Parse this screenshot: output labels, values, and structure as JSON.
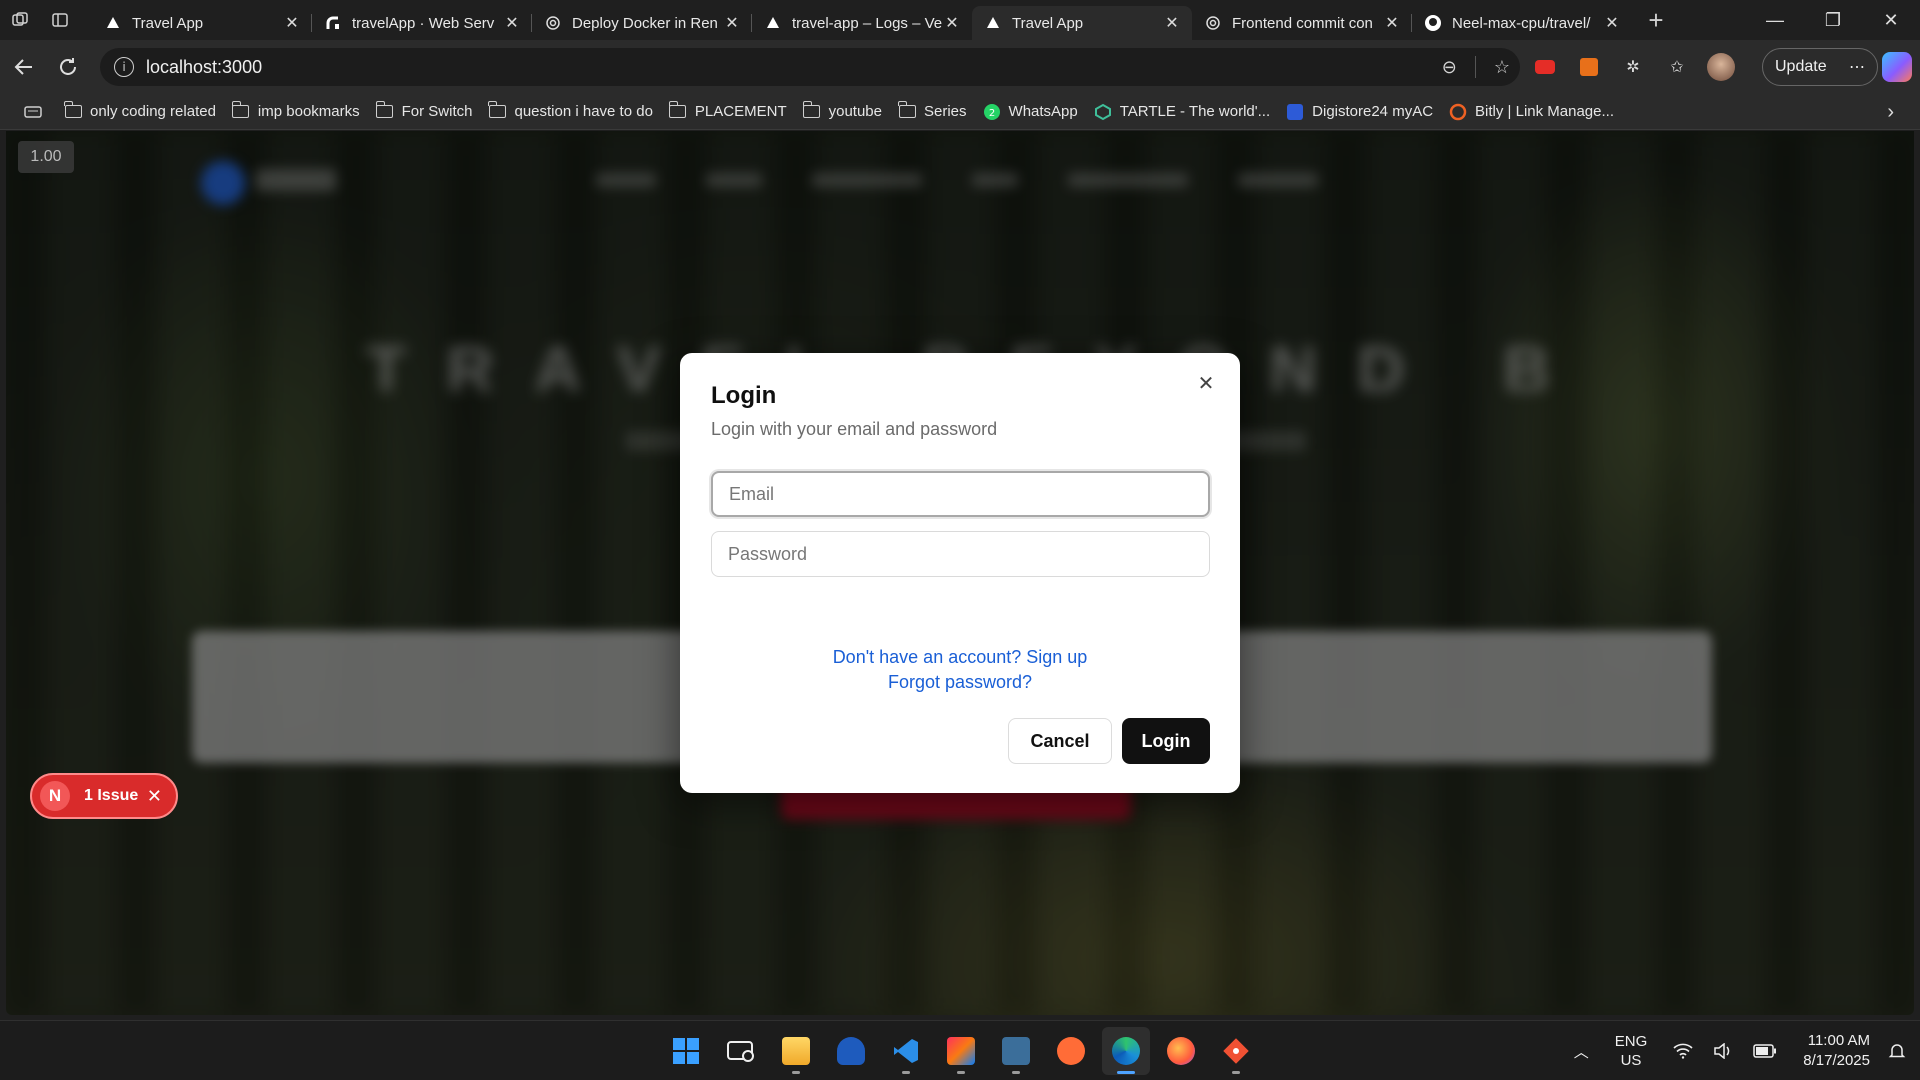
{
  "browser": {
    "tabs": [
      {
        "title": "Travel App",
        "favicon": "vercel-triangle-icon",
        "active": false
      },
      {
        "title": "travelApp · Web Serv",
        "favicon": "render-icon",
        "active": false
      },
      {
        "title": "Deploy Docker in Ren",
        "favicon": "chatgpt-icon",
        "active": false
      },
      {
        "title": "travel-app – Logs – Ve",
        "favicon": "vercel-triangle-icon",
        "active": false
      },
      {
        "title": "Travel App",
        "favicon": "vercel-triangle-icon",
        "active": true
      },
      {
        "title": "Frontend commit con",
        "favicon": "chatgpt-icon",
        "active": false
      },
      {
        "title": "Neel-max-cpu/travel/",
        "favicon": "github-icon",
        "active": false
      }
    ],
    "url": "localhost:3000",
    "update_label": "Update",
    "bookmarks": [
      {
        "label": "only coding  related",
        "icon": "folder-icon"
      },
      {
        "label": "imp bookmarks",
        "icon": "folder-icon"
      },
      {
        "label": "For Switch",
        "icon": "folder-icon"
      },
      {
        "label": "question i have to do",
        "icon": "folder-icon"
      },
      {
        "label": "PLACEMENT",
        "icon": "folder-icon"
      },
      {
        "label": "youtube",
        "icon": "folder-icon"
      },
      {
        "label": "Series",
        "icon": "folder-icon"
      },
      {
        "label": "WhatsApp",
        "icon": "whatsapp-icon"
      },
      {
        "label": "TARTLE - The world'...",
        "icon": "tartle-icon"
      },
      {
        "label": "Digistore24 myAC",
        "icon": "digistore-icon"
      },
      {
        "label": "Bitly | Link Manage...",
        "icon": "bitly-icon"
      }
    ]
  },
  "page": {
    "zoom_badge": "1.00",
    "hero_blurred_text": "TRAVEL BEYOND BOUNDARIES",
    "issue_badge": {
      "letter": "N",
      "label": "1 Issue"
    }
  },
  "modal": {
    "title": "Login",
    "description": "Login with your email and password",
    "email_placeholder": "Email",
    "password_placeholder": "Password",
    "signup_link": "Don't have an account? Sign up",
    "forgot_link": "Forgot password?",
    "cancel_label": "Cancel",
    "login_label": "Login"
  },
  "taskbar": {
    "language": {
      "line1": "ENG",
      "line2": "US"
    },
    "time": "11:00 AM",
    "date": "8/17/2025",
    "apps": [
      "windows-start-icon",
      "task-view-icon",
      "file-explorer-icon",
      "db-tool-icon",
      "vscode-icon",
      "intellij-icon",
      "mysql-workbench-icon",
      "postman-icon",
      "edge-icon",
      "firefox-icon",
      "git-icon"
    ]
  },
  "colors": {
    "link": "#1a5fd6",
    "primary_button": "#111111",
    "issue_badge": "#d92b2b",
    "accent": "#4ea3ff"
  }
}
